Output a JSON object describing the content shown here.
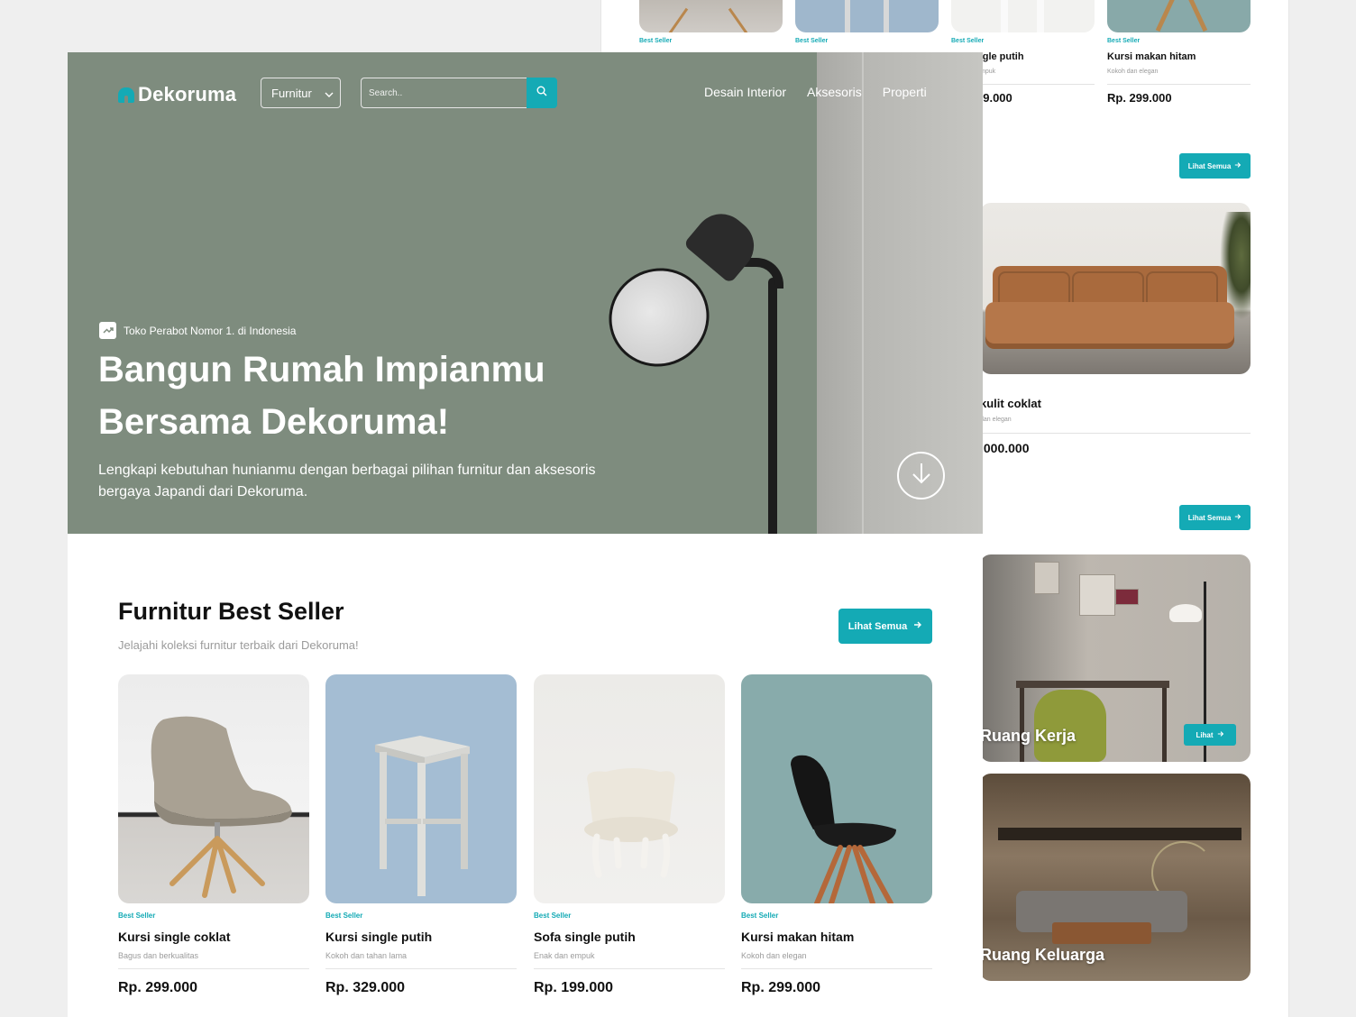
{
  "back_page": {
    "products": [
      {
        "badge": "Best Seller",
        "name": "",
        "desc": "",
        "price": ""
      },
      {
        "badge": "Best Seller",
        "name": "",
        "desc": "",
        "price": ""
      },
      {
        "badge": "Best Seller",
        "name": "ngle putih",
        "desc": "mpuk",
        "price": "99.000"
      },
      {
        "badge": "Best Seller",
        "name": "Kursi makan hitam",
        "desc": "Kokoh dan elegan",
        "price": "Rp. 299.000"
      }
    ],
    "see_all_1": "Lihat Semua",
    "sofa": {
      "name": "kulit coklat",
      "desc": "dan elegan",
      "price": ".000.000"
    },
    "see_all_2": "Lihat Semua",
    "rooms": [
      {
        "label": "Ruang Kerja",
        "button": "Lihat"
      },
      {
        "label": "Ruang Keluarga"
      }
    ]
  },
  "header": {
    "logo": "Dekoruma",
    "category_select": "Furnitur",
    "search_placeholder": "Search..",
    "nav": [
      "Desain Interior",
      "Aksesoris",
      "Properti"
    ]
  },
  "hero": {
    "tagline": "Toko Perabot Nomor 1. di Indonesia",
    "title_line1": "Bangun Rumah Impianmu",
    "title_line2": "Bersama Dekoruma!",
    "description": "Lengkapi kebutuhan hunianmu dengan berbagai pilihan furnitur dan aksesoris bergaya Japandi dari Dekoruma."
  },
  "best_seller": {
    "title": "Furnitur Best Seller",
    "subtitle": "Jelajahi koleksi furnitur terbaik dari Dekoruma!",
    "see_all": "Lihat Semua",
    "products": [
      {
        "badge": "Best Seller",
        "name": "Kursi single coklat",
        "desc": "Bagus dan berkualitas",
        "price": "Rp. 299.000"
      },
      {
        "badge": "Best Seller",
        "name": "Kursi single putih",
        "desc": "Kokoh dan tahan lama",
        "price": "Rp. 329.000"
      },
      {
        "badge": "Best Seller",
        "name": "Sofa single putih",
        "desc": "Enak dan empuk",
        "price": "Rp. 199.000"
      },
      {
        "badge": "Best Seller",
        "name": "Kursi makan hitam",
        "desc": "Kokoh dan elegan",
        "price": "Rp. 299.000"
      }
    ]
  },
  "colors": {
    "accent": "#14aab5",
    "hero_bg": "#7e8c7e",
    "text": "#111111",
    "muted": "#9b9b9b"
  },
  "icons": [
    "home-logo-icon",
    "chevron-down-icon",
    "search-icon",
    "trending-up-icon",
    "arrow-down-circle-icon",
    "arrow-right-icon"
  ]
}
